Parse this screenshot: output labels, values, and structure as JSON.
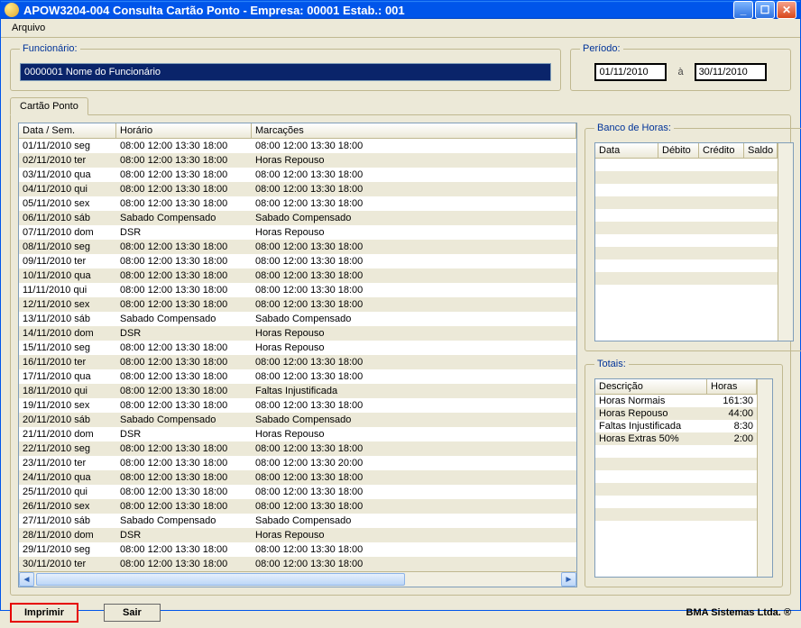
{
  "window": {
    "title": "APOW3204-004 Consulta Cartão Ponto - Empresa: 00001 Estab.: 001"
  },
  "menu": {
    "arquivo": "Arquivo"
  },
  "funcionario": {
    "legend": "Funcionário:",
    "value": "0000001 Nome do Funcionário"
  },
  "periodo": {
    "legend": "Período:",
    "from": "01/11/2010",
    "sep": "à",
    "to": "30/11/2010"
  },
  "tab": {
    "label": "Cartão Ponto"
  },
  "grid": {
    "headers": {
      "data": "Data / Sem.",
      "horario": "Horário",
      "marcacoes": "Marcações"
    },
    "rows": [
      {
        "d": "01/11/2010 seg",
        "h": "08:00  12:00  13:30  18:00",
        "m": "08:00  12:00  13:30  18:00"
      },
      {
        "d": "02/11/2010 ter",
        "h": "08:00  12:00  13:30  18:00",
        "m": "Horas Repouso"
      },
      {
        "d": "03/11/2010 qua",
        "h": "08:00  12:00  13:30  18:00",
        "m": "08:00  12:00  13:30  18:00"
      },
      {
        "d": "04/11/2010 qui",
        "h": "08:00  12:00  13:30  18:00",
        "m": "08:00  12:00  13:30  18:00"
      },
      {
        "d": "05/11/2010 sex",
        "h": "08:00  12:00  13:30  18:00",
        "m": "08:00  12:00  13:30  18:00"
      },
      {
        "d": "06/11/2010 sáb",
        "h": "Sabado Compensado",
        "m": "Sabado Compensado"
      },
      {
        "d": "07/11/2010 dom",
        "h": "DSR",
        "m": "Horas Repouso"
      },
      {
        "d": "08/11/2010 seg",
        "h": "08:00  12:00  13:30  18:00",
        "m": "08:00  12:00  13:30  18:00"
      },
      {
        "d": "09/11/2010 ter",
        "h": "08:00  12:00  13:30  18:00",
        "m": "08:00  12:00  13:30  18:00"
      },
      {
        "d": "10/11/2010 qua",
        "h": "08:00  12:00  13:30  18:00",
        "m": "08:00  12:00  13:30  18:00"
      },
      {
        "d": "11/11/2010 qui",
        "h": "08:00  12:00  13:30  18:00",
        "m": "08:00  12:00  13:30  18:00"
      },
      {
        "d": "12/11/2010 sex",
        "h": "08:00  12:00  13:30  18:00",
        "m": "08:00  12:00  13:30  18:00"
      },
      {
        "d": "13/11/2010 sáb",
        "h": "Sabado Compensado",
        "m": "Sabado Compensado"
      },
      {
        "d": "14/11/2010 dom",
        "h": "DSR",
        "m": "Horas Repouso"
      },
      {
        "d": "15/11/2010 seg",
        "h": "08:00  12:00  13:30  18:00",
        "m": "Horas Repouso"
      },
      {
        "d": "16/11/2010 ter",
        "h": "08:00  12:00  13:30  18:00",
        "m": "08:00  12:00  13:30  18:00"
      },
      {
        "d": "17/11/2010 qua",
        "h": "08:00  12:00  13:30  18:00",
        "m": "08:00  12:00  13:30  18:00"
      },
      {
        "d": "18/11/2010 qui",
        "h": "08:00  12:00  13:30  18:00",
        "m": "Faltas Injustificada"
      },
      {
        "d": "19/11/2010 sex",
        "h": "08:00  12:00  13:30  18:00",
        "m": "08:00  12:00  13:30  18:00"
      },
      {
        "d": "20/11/2010 sáb",
        "h": "Sabado Compensado",
        "m": "Sabado Compensado"
      },
      {
        "d": "21/11/2010 dom",
        "h": "DSR",
        "m": "Horas Repouso"
      },
      {
        "d": "22/11/2010 seg",
        "h": "08:00  12:00  13:30  18:00",
        "m": "08:00  12:00  13:30  18:00"
      },
      {
        "d": "23/11/2010 ter",
        "h": "08:00  12:00  13:30  18:00",
        "m": "08:00  12:00  13:30  20:00"
      },
      {
        "d": "24/11/2010 qua",
        "h": "08:00  12:00  13:30  18:00",
        "m": "08:00  12:00  13:30  18:00"
      },
      {
        "d": "25/11/2010 qui",
        "h": "08:00  12:00  13:30  18:00",
        "m": "08:00  12:00  13:30  18:00"
      },
      {
        "d": "26/11/2010 sex",
        "h": "08:00  12:00  13:30  18:00",
        "m": "08:00  12:00  13:30  18:00"
      },
      {
        "d": "27/11/2010 sáb",
        "h": "Sabado Compensado",
        "m": "Sabado Compensado"
      },
      {
        "d": "28/11/2010 dom",
        "h": "DSR",
        "m": "Horas Repouso"
      },
      {
        "d": "29/11/2010 seg",
        "h": "08:00  12:00  13:30  18:00",
        "m": "08:00  12:00  13:30  18:00"
      },
      {
        "d": "30/11/2010 ter",
        "h": "08:00  12:00  13:30  18:00",
        "m": "08:00  12:00  13:30  18:00"
      }
    ]
  },
  "banco": {
    "legend": "Banco de Horas:",
    "headers": {
      "data": "Data",
      "debito": "Débito",
      "credito": "Crédito",
      "saldo": "Saldo"
    }
  },
  "totais": {
    "legend": "Totais:",
    "headers": {
      "descricao": "Descrição",
      "horas": "Horas"
    },
    "rows": [
      {
        "desc": "Horas Normais",
        "h": "161:30"
      },
      {
        "desc": "Horas Repouso",
        "h": "44:00"
      },
      {
        "desc": "Faltas Injustificada",
        "h": "8:30"
      },
      {
        "desc": "Horas Extras 50%",
        "h": "2:00"
      }
    ]
  },
  "buttons": {
    "imprimir": "Imprimir",
    "sair": "Sair"
  },
  "footer": "BMA Sistemas Ltda. ®"
}
